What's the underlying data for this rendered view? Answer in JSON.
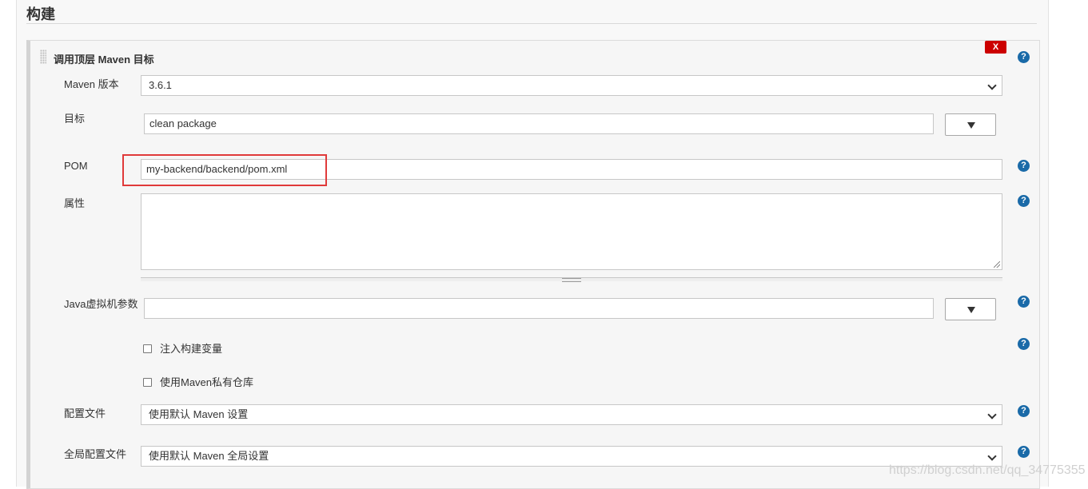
{
  "section": {
    "title": "构建"
  },
  "step": {
    "title": "调用顶层 Maven 目标",
    "delete_label": "X"
  },
  "help": {
    "glyph": "?"
  },
  "fields": {
    "maven_version": {
      "label": "Maven 版本",
      "value": "3.6.1"
    },
    "goals": {
      "label": "目标",
      "value": "clean package"
    },
    "pom": {
      "label": "POM",
      "value": "my-backend/backend/pom.xml"
    },
    "properties": {
      "label": "属性",
      "value": ""
    },
    "jvm_options": {
      "label": "Java虚拟机参数",
      "value": ""
    },
    "inject_build_vars": {
      "label": "注入构建变量",
      "checked": false
    },
    "private_repo": {
      "label": "使用Maven私有仓库",
      "checked": false
    },
    "settings_file": {
      "label": "配置文件",
      "value": "使用默认 Maven 设置"
    },
    "global_settings_file": {
      "label": "全局配置文件",
      "value": "使用默认 Maven 全局设置"
    }
  },
  "watermark": "https://blog.csdn.net/qq_34775355",
  "colors": {
    "help_icon": "#1a6aa8",
    "delete_button": "#cc0000",
    "highlight_box": "#e03a3a"
  }
}
